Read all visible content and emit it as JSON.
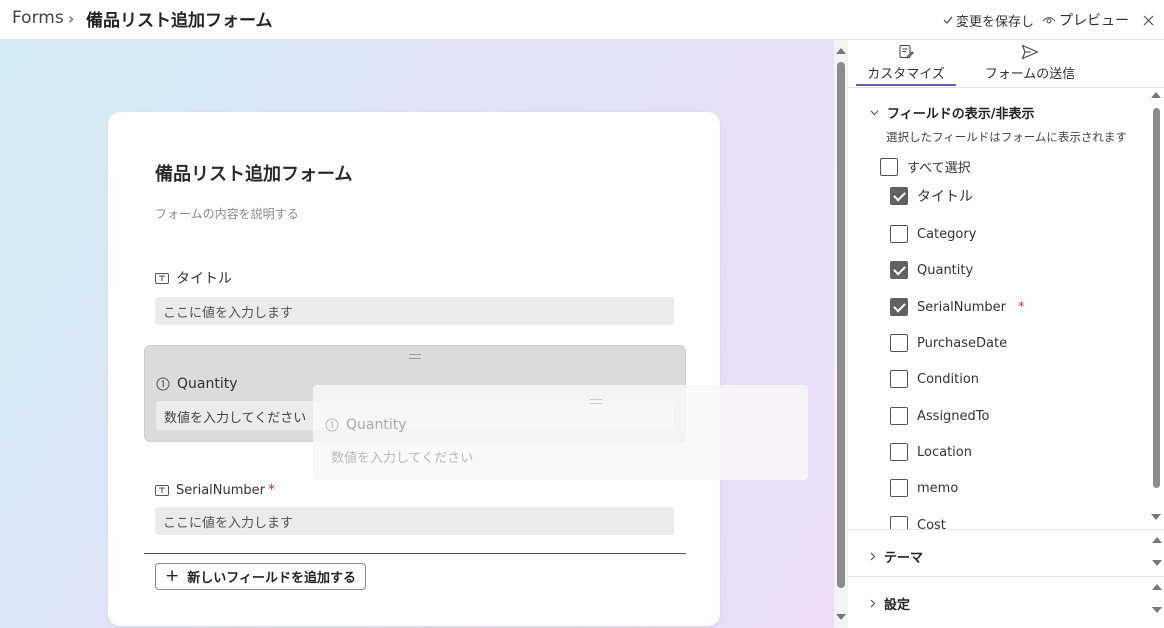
{
  "header": {
    "root": "Forms",
    "separator": "›",
    "title": "備品リスト追加フォーム",
    "save_label": "変更を保存し",
    "preview_label": "プレビュー"
  },
  "form": {
    "title": "備品リスト追加フォーム",
    "description": "フォームの内容を説明する",
    "fields": {
      "title_field": {
        "label": "タイトル",
        "placeholder": "ここに値を入力します"
      },
      "quantity_field": {
        "label": "Quantity",
        "placeholder": "数値を入力してください"
      },
      "serial_field": {
        "label": "SerialNumber",
        "required_mark": "*",
        "placeholder": "ここに値を入力します"
      }
    },
    "add_field_label": "新しいフィールドを追加する"
  },
  "panel": {
    "tabs": {
      "customize": "カスタマイズ",
      "send": "フォームの送信"
    },
    "fields_section": {
      "title": "フィールドの表示/非表示",
      "hint": "選択したフィールドはフォームに表示されます",
      "select_all": "すべて選択",
      "items": [
        {
          "label": "タイトル",
          "checked": true
        },
        {
          "label": "Category",
          "checked": false
        },
        {
          "label": "Quantity",
          "checked": true
        },
        {
          "label": "SerialNumber",
          "checked": true,
          "required_mark": "*"
        },
        {
          "label": "PurchaseDate",
          "checked": false
        },
        {
          "label": "Condition",
          "checked": false
        },
        {
          "label": "AssignedTo",
          "checked": false
        },
        {
          "label": "Location",
          "checked": false
        },
        {
          "label": "memo",
          "checked": false
        },
        {
          "label": "Cost",
          "checked": false
        }
      ]
    },
    "theme_section": "テーマ",
    "settings_section": "設定"
  },
  "colors": {
    "accent": "#5b5fc7",
    "required": "#c4314b"
  }
}
